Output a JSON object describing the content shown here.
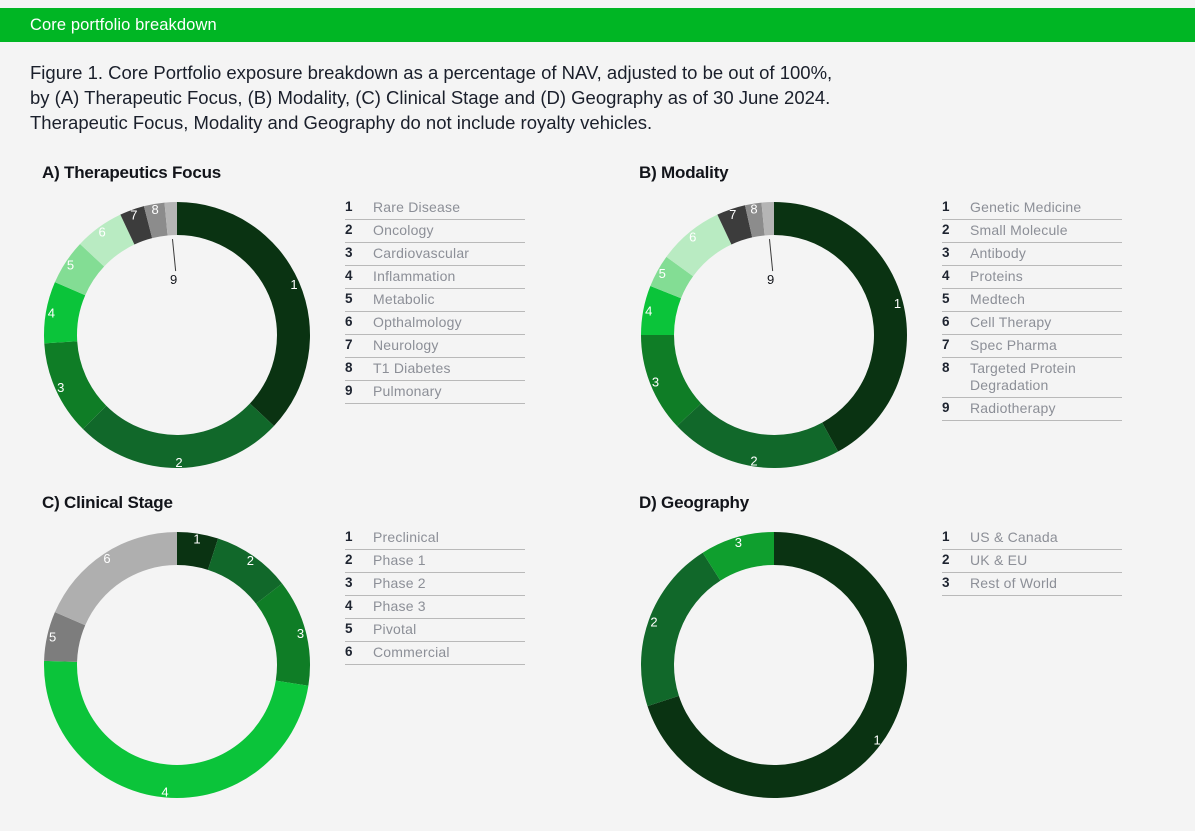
{
  "header": {
    "title": "Core portfolio breakdown",
    "bar_color": "#00b624"
  },
  "caption": {
    "line1": "Figure 1. Core Portfolio exposure breakdown as a percentage of NAV, adjusted to be out of 100%,",
    "line2": "by (A) Therapeutic Focus, (B) Modality, (C) Clinical Stage and (D) Geography as of 30 June 2024.",
    "line3": "Therapeutic Focus, Modality and Geography do not include royalty vehicles."
  },
  "chart_data": [
    {
      "id": "therapeutics-focus",
      "type": "pie",
      "title": "A) Therapeutics Focus",
      "donut": true,
      "start_angle": 0,
      "categories": [
        "Rare Disease",
        "Oncology",
        "Cardiovascular",
        "Inflammation",
        "Metabolic",
        "Opthalmology",
        "Neurology",
        "T1 Diabetes",
        "Pulmonary"
      ],
      "values": [
        37.0,
        25.5,
        11.5,
        7.5,
        5.5,
        6.0,
        3.0,
        2.5,
        1.5
      ],
      "colors": [
        "#0a3312",
        "#11682a",
        "#0f7d26",
        "#0bc43a",
        "#83dd94",
        "#b9ebc2",
        "#3c3c3c",
        "#8c8c8c",
        "#b5b5b5"
      ],
      "label_colors": [
        "#ffffff",
        "#ffffff",
        "#ffffff",
        "#ffffff",
        "#ffffff",
        "#12141a",
        "#ffffff",
        "#ffffff",
        "#12141a"
      ],
      "legend": [
        {
          "num": "1",
          "label": "Rare Disease"
        },
        {
          "num": "2",
          "label": "Oncology"
        },
        {
          "num": "3",
          "label": "Cardiovascular"
        },
        {
          "num": "4",
          "label": "Inflammation"
        },
        {
          "num": "5",
          "label": "Metabolic"
        },
        {
          "num": "6",
          "label": "Opthalmology"
        },
        {
          "num": "7",
          "label": "Neurology"
        },
        {
          "num": "8",
          "label": "T1 Diabetes"
        },
        {
          "num": "9",
          "label": "Pulmonary"
        }
      ],
      "callout_index": 8
    },
    {
      "id": "modality",
      "type": "pie",
      "title": "B) Modality",
      "donut": true,
      "start_angle": 0,
      "categories": [
        "Genetic Medicine",
        "Small Molecule",
        "Antibody",
        "Proteins",
        "Medtech",
        "Cell Therapy",
        "Spec Pharma",
        "Targeted Protein Degradation",
        "Radiotherapy"
      ],
      "values": [
        42.0,
        21.0,
        12.0,
        6.0,
        4.0,
        8.0,
        3.5,
        2.0,
        1.5
      ],
      "colors": [
        "#0a3312",
        "#11682a",
        "#0f7d26",
        "#0bc43a",
        "#83dd94",
        "#b9ebc2",
        "#3c3c3c",
        "#8c8c8c",
        "#b5b5b5"
      ],
      "label_colors": [
        "#ffffff",
        "#ffffff",
        "#ffffff",
        "#ffffff",
        "#ffffff",
        "#12141a",
        "#ffffff",
        "#ffffff",
        "#12141a"
      ],
      "legend": [
        {
          "num": "1",
          "label": "Genetic Medicine"
        },
        {
          "num": "2",
          "label": "Small Molecule"
        },
        {
          "num": "3",
          "label": "Antibody"
        },
        {
          "num": "4",
          "label": "Proteins"
        },
        {
          "num": "5",
          "label": "Medtech"
        },
        {
          "num": "6",
          "label": "Cell Therapy"
        },
        {
          "num": "7",
          "label": "Spec Pharma"
        },
        {
          "num": "8",
          "label": "Targeted Protein Degradation"
        },
        {
          "num": "9",
          "label": "Radiotherapy"
        }
      ],
      "callout_index": 8
    },
    {
      "id": "clinical-stage",
      "type": "pie",
      "title": "C) Clinical Stage",
      "donut": true,
      "start_angle": 0,
      "categories": [
        "Preclinical",
        "Phase 1",
        "Phase 2",
        "Phase 3",
        "Pivotal",
        "Commercial"
      ],
      "values": [
        5.0,
        9.5,
        13.0,
        48.0,
        6.0,
        18.5
      ],
      "colors": [
        "#0a3312",
        "#11682a",
        "#0f7d26",
        "#0bc43a",
        "#7d7d7d",
        "#afafaf"
      ],
      "label_colors": [
        "#ffffff",
        "#ffffff",
        "#ffffff",
        "#ffffff",
        "#ffffff",
        "#ffffff"
      ],
      "legend": [
        {
          "num": "1",
          "label": "Preclinical"
        },
        {
          "num": "2",
          "label": "Phase 1"
        },
        {
          "num": "3",
          "label": "Phase 2"
        },
        {
          "num": "4",
          "label": "Phase 3"
        },
        {
          "num": "5",
          "label": "Pivotal"
        },
        {
          "num": "6",
          "label": "Commercial"
        }
      ],
      "callout_index": -1
    },
    {
      "id": "geography",
      "type": "pie",
      "title": "D) Geography",
      "donut": true,
      "start_angle": 0,
      "categories": [
        "US & Canada",
        "UK & EU",
        "Rest of World"
      ],
      "values": [
        70.0,
        21.0,
        9.0
      ],
      "colors": [
        "#0a3312",
        "#11682a",
        "#0f9f2e"
      ],
      "label_colors": [
        "#ffffff",
        "#ffffff",
        "#ffffff"
      ],
      "legend": [
        {
          "num": "1",
          "label": "US & Canada"
        },
        {
          "num": "2",
          "label": "UK & EU"
        },
        {
          "num": "3",
          "label": "Rest of World"
        }
      ],
      "callout_index": -1
    }
  ]
}
